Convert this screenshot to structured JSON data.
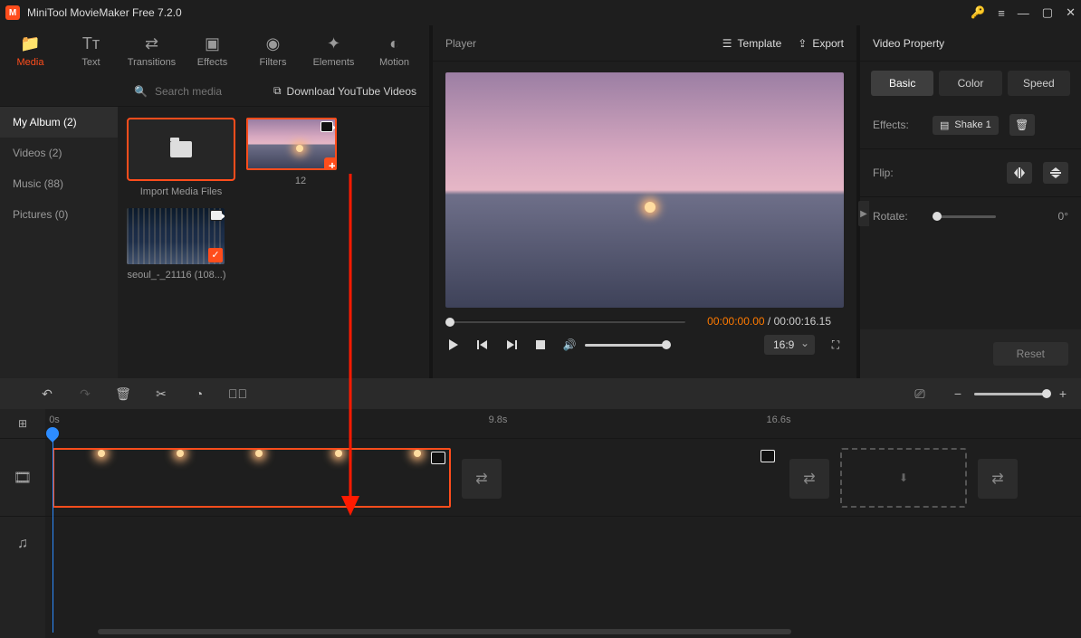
{
  "titlebar": {
    "app_title": "MiniTool MovieMaker Free 7.2.0"
  },
  "tabs": {
    "media": "Media",
    "text": "Text",
    "transitions": "Transitions",
    "effects": "Effects",
    "filters": "Filters",
    "elements": "Elements",
    "motion": "Motion"
  },
  "albums": {
    "my_album": "My Album (2)",
    "videos": "Videos (2)",
    "music": "Music (88)",
    "pictures": "Pictures (0)"
  },
  "search": {
    "placeholder": "Search media"
  },
  "youtube_link": "Download YouTube Videos",
  "media_items": {
    "import_label": "Import Media Files",
    "clip1_label": "12",
    "clip2_label": "seoul_-_21116 (108...)"
  },
  "player": {
    "title": "Player",
    "template_label": "Template",
    "export_label": "Export",
    "current_time": "00:00:00.00",
    "separator": " / ",
    "total_time": "00:00:16.15",
    "aspect": "16:9"
  },
  "property": {
    "title": "Video Property",
    "tab_basic": "Basic",
    "tab_color": "Color",
    "tab_speed": "Speed",
    "effects_label": "Effects:",
    "effect_name": "Shake 1",
    "flip_label": "Flip:",
    "rotate_label": "Rotate:",
    "rotate_value": "0°",
    "reset": "Reset"
  },
  "ruler": {
    "t0": "0s",
    "t1": "9.8s",
    "t2": "16.6s"
  }
}
